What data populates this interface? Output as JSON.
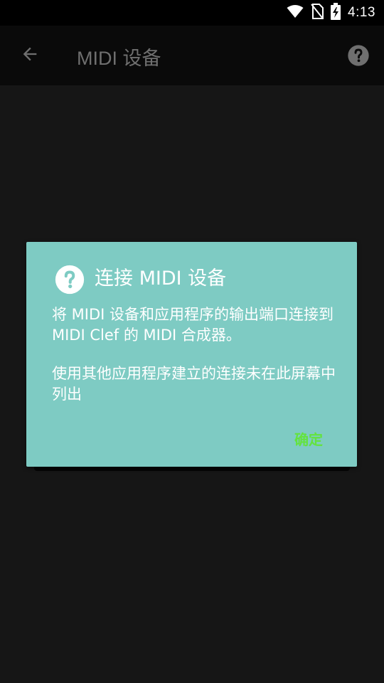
{
  "status_bar": {
    "time": "4:13",
    "icons": [
      "wifi-icon",
      "no-sim-icon",
      "battery-charging-icon"
    ]
  },
  "app_bar": {
    "title": "MIDI 设备",
    "back_icon": "arrow-back-icon",
    "help_icon": "help-icon"
  },
  "dialog": {
    "icon": "help-icon",
    "title": "连接 MIDI 设备",
    "paragraph1": "将 MIDI 设备和应用程序的输出端口连接到 MIDI Clef 的 MIDI 合成器。",
    "paragraph2": "使用其他应用程序建立的连接未在此屏幕中列出",
    "ok_label": "确定",
    "background_color": "#7ecbc3",
    "ok_color": "#63e33e"
  }
}
